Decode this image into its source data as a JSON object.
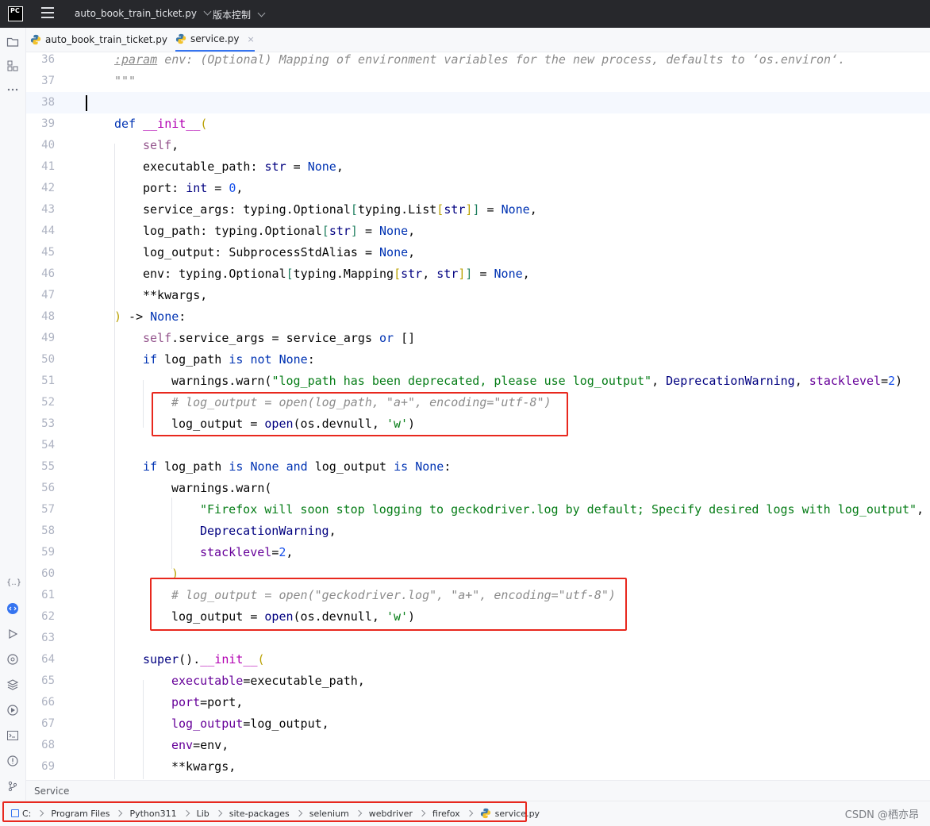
{
  "titlebar": {
    "logo_text": "PC",
    "project_name": "auto_book_train_ticket.py",
    "vcs_label": "版本控制"
  },
  "tabs": [
    {
      "label": "auto_book_train_ticket.py",
      "active": false
    },
    {
      "label": "service.py",
      "active": true,
      "close": "×"
    }
  ],
  "editor": {
    "lines": [
      {
        "n": "36"
      },
      {
        "n": "37"
      },
      {
        "n": "38"
      },
      {
        "n": "39"
      },
      {
        "n": "40"
      },
      {
        "n": "41"
      },
      {
        "n": "42"
      },
      {
        "n": "43"
      },
      {
        "n": "44"
      },
      {
        "n": "45"
      },
      {
        "n": "46"
      },
      {
        "n": "47"
      },
      {
        "n": "48"
      },
      {
        "n": "49"
      },
      {
        "n": "50"
      },
      {
        "n": "51"
      },
      {
        "n": "52"
      },
      {
        "n": "53"
      },
      {
        "n": "54"
      },
      {
        "n": "55"
      },
      {
        "n": "56"
      },
      {
        "n": "57"
      },
      {
        "n": "58"
      },
      {
        "n": "59"
      },
      {
        "n": "60"
      },
      {
        "n": "61"
      },
      {
        "n": "62"
      },
      {
        "n": "63"
      },
      {
        "n": "64"
      },
      {
        "n": "65"
      },
      {
        "n": "66"
      },
      {
        "n": "67"
      },
      {
        "n": "68"
      },
      {
        "n": "69"
      }
    ],
    "t36a": ":param",
    "t36b": " env: (Optional) Mapping of environment variables for the new process, defaults to ‘os.environ‘.",
    "t37": "\"\"\"",
    "t39_def": "def",
    "t39_init": "__init__",
    "t39_p": "(",
    "t40_self": "self",
    "t40_c": ",",
    "t41a": "executable_path: ",
    "t41b": "str",
    "t41c": " = ",
    "t41d": "None",
    "t41e": ",",
    "t42a": "port: ",
    "t42b": "int",
    "t42c": " = ",
    "t42d": "0",
    "t42e": ",",
    "t43a": "service_args: typing.Optional",
    "t43b": "[",
    "t43c": "typing.List",
    "t43d": "[",
    "t43e": "str",
    "t43f": "]",
    "t43g": "]",
    "t43h": " = ",
    "t43i": "None",
    "t43j": ",",
    "t44a": "log_path: typing.Optional",
    "t44b": "[",
    "t44c": "str",
    "t44d": "]",
    "t44e": " = ",
    "t44f": "None",
    "t44g": ",",
    "t45a": "log_output: SubprocessStdAlias = ",
    "t45b": "None",
    "t45c": ",",
    "t46a": "env: typing.Optional",
    "t46b": "[",
    "t46c": "typing.Mapping",
    "t46d": "[",
    "t46e": "str",
    "t46f": ", ",
    "t46g": "str",
    "t46h": "]",
    "t46i": "]",
    "t46j": " = ",
    "t46k": "None",
    "t46l": ",",
    "t47": "**kwargs,",
    "t48a": ")",
    "t48b": " -> ",
    "t48c": "None",
    "t48d": ":",
    "t49a": "self",
    "t49b": ".service_args = service_args ",
    "t49c": "or",
    "t49d": " []",
    "t50a": "if",
    "t50b": " log_path ",
    "t50c": "is not",
    "t50d": " ",
    "t50e": "None",
    "t50f": ":",
    "t51a": "warnings.warn(",
    "t51b": "\"log_path has been deprecated, please use log_output\"",
    "t51c": ", ",
    "t51d": "DeprecationWarning",
    "t51e": ", ",
    "t51f": "stacklevel",
    "t51g": "=",
    "t51h": "2",
    "t51i": ")",
    "t52": "# log_output = open(log_path, \"a+\", encoding=\"utf-8\")",
    "t53a": "log_output = ",
    "t53b": "open",
    "t53c": "(os.devnull, ",
    "t53d": "'w'",
    "t53e": ")",
    "t55a": "if",
    "t55b": " log_path ",
    "t55c": "is",
    "t55d": " ",
    "t55e": "None",
    "t55f": " ",
    "t55g": "and",
    "t55h": " log_output ",
    "t55i": "is",
    "t55j": " ",
    "t55k": "None",
    "t55l": ":",
    "t56": "warnings.warn(",
    "t57a": "\"Firefox will soon stop logging to geckodriver.log by default; Specify desired logs with log_output\"",
    "t57b": ",",
    "t58": "DeprecationWarning",
    "t58b": ",",
    "t59a": "stacklevel",
    "t59b": "=",
    "t59c": "2",
    "t59d": ",",
    "t60": ")",
    "t61": "# log_output = open(\"geckodriver.log\", \"a+\", encoding=\"utf-8\")",
    "t62a": "log_output = ",
    "t62b": "open",
    "t62c": "(os.devnull, ",
    "t62d": "'w'",
    "t62e": ")",
    "t64a": "super",
    "t64b": "().",
    "t64c": "__init__",
    "t64d": "(",
    "t65a": "executable",
    "t65b": "=executable_path,",
    "t66a": "port",
    "t66b": "=port,",
    "t67a": "log_output",
    "t67b": "=log_output,",
    "t68a": "env",
    "t68b": "=env,",
    "t69": "**kwargs,"
  },
  "bottom": {
    "panel_title": "Service",
    "breadcrumb": [
      "C:",
      "Program Files",
      "Python311",
      "Lib",
      "site-packages",
      "selenium",
      "webdriver",
      "firefox",
      "service.py"
    ],
    "watermark": "CSDN @栖亦昂"
  },
  "colors": {
    "highlight_box": "#e8281e",
    "accent": "#3574f0"
  }
}
